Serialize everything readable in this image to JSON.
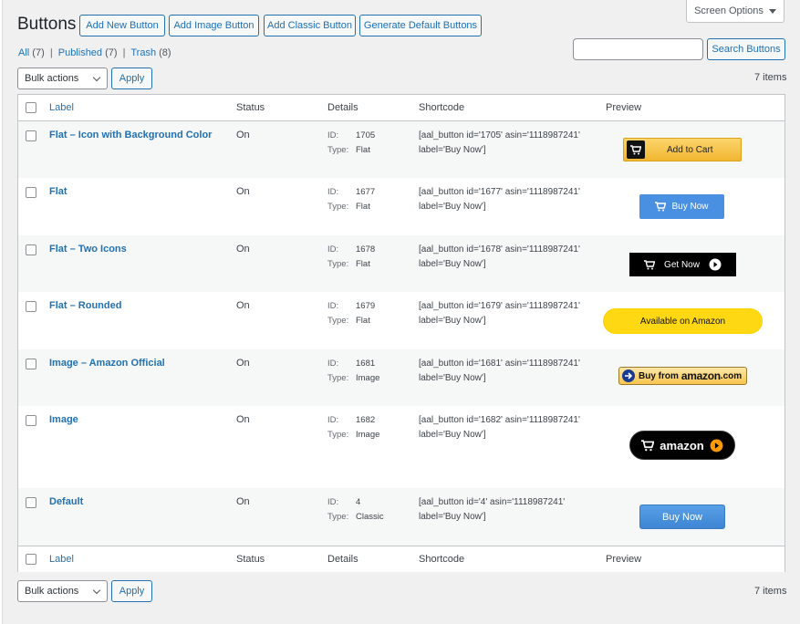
{
  "page": {
    "title": "Buttons",
    "actions": [
      "Add New Button",
      "Add Image Button",
      "Add Classic Button",
      "Generate Default Buttons"
    ],
    "screen_options": "Screen Options",
    "search_button": "Search Buttons",
    "search_placeholder": ""
  },
  "filters": {
    "all": "All",
    "all_count": "(7)",
    "published": "Published",
    "published_count": "(7)",
    "trash": "Trash",
    "trash_count": "(8)",
    "sep": "|"
  },
  "bulk": {
    "selected": "Bulk actions",
    "apply": "Apply",
    "items": "7 items"
  },
  "columns": {
    "label": "Label",
    "status": "Status",
    "details": "Details",
    "shortcode": "Shortcode",
    "preview": "Preview"
  },
  "detail_keys": {
    "id": "ID:",
    "type": "Type:"
  },
  "rows": [
    {
      "label": "Flat – Icon with Background Color",
      "status": "On",
      "id": "1705",
      "type": "Flat",
      "shortcode_1": "[aal_button id='1705' asin='1118987241'",
      "shortcode_2": "label='Buy Now']",
      "preview_text": "Add to Cart",
      "preview_style": "gold-cart"
    },
    {
      "label": "Flat",
      "status": "On",
      "id": "1677",
      "type": "Flat",
      "shortcode_1": "[aal_button id='1677' asin='1118987241'",
      "shortcode_2": "label='Buy Now']",
      "preview_text": "Buy Now",
      "preview_style": "blue-cart"
    },
    {
      "label": "Flat – Two Icons",
      "status": "On",
      "id": "1678",
      "type": "Flat",
      "shortcode_1": "[aal_button id='1678' asin='1118987241'",
      "shortcode_2": "label='Buy Now']",
      "preview_text": "Get Now",
      "preview_style": "black-two-icons"
    },
    {
      "label": "Flat – Rounded",
      "status": "On",
      "id": "1679",
      "type": "Flat",
      "shortcode_1": "[aal_button id='1679' asin='1118987241'",
      "shortcode_2": "label='Buy Now']",
      "preview_text": "Available on Amazon",
      "preview_style": "yellow-rounded"
    },
    {
      "label": "Image – Amazon Official",
      "status": "On",
      "id": "1681",
      "type": "Image",
      "shortcode_1": "[aal_button id='1681' asin='1118987241'",
      "shortcode_2": "label='Buy Now']",
      "preview_text": "Buy from",
      "preview_text_2": "amazon",
      "preview_text_3": ".com",
      "preview_style": "amazon-official"
    },
    {
      "label": "Image",
      "status": "On",
      "id": "1682",
      "type": "Image",
      "shortcode_1": "[aal_button id='1682' asin='1118987241'",
      "shortcode_2": "label='Buy Now']",
      "preview_text": "amazon",
      "preview_style": "black-pill"
    },
    {
      "label": "Default",
      "status": "On",
      "id": "4",
      "type": "Classic",
      "shortcode_1": "[aal_button id='4' asin='1118987241'",
      "shortcode_2": "label='Buy Now']",
      "preview_text": "Buy Now",
      "preview_style": "classic-blue"
    }
  ],
  "colors": {
    "link": "#2271b1",
    "gold": "#f4c13b",
    "blue": "#4a90e2",
    "amazon_orange": "#ff9900",
    "yellow": "#ffd814"
  }
}
